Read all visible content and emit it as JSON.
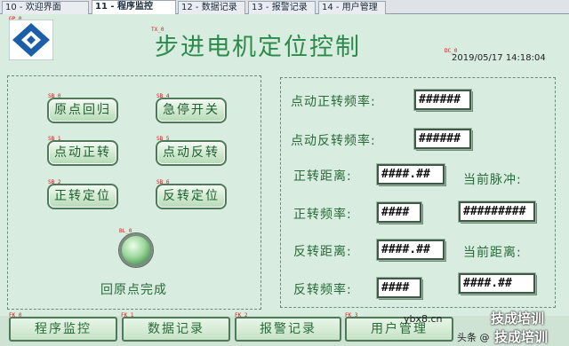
{
  "tabs": [
    {
      "label": "10 - 欢迎界面",
      "active": false
    },
    {
      "label": "11 - 程序监控",
      "active": true
    },
    {
      "label": "12 - 数据记录",
      "active": false
    },
    {
      "label": "13 - 报警记录",
      "active": false
    },
    {
      "label": "14 - 用户管理",
      "active": false
    }
  ],
  "header": {
    "title": "步进电机定位控制",
    "datetime": "2019/05/17 14:18:04",
    "logo_tag": "GP_0",
    "title_tag": "TX_0",
    "date_tag": "DC_0"
  },
  "left_panel": {
    "buttons": [
      {
        "label": "原点回归",
        "tag": "SB_0"
      },
      {
        "label": "急停开关",
        "tag": "SB_4"
      },
      {
        "label": "点动正转",
        "tag": "SB_1"
      },
      {
        "label": "点动反转",
        "tag": "SB_5"
      },
      {
        "label": "正转定位",
        "tag": "SB_2"
      },
      {
        "label": "反转定位",
        "tag": "SB_6"
      }
    ],
    "lamp_tag": "BL_0",
    "lamp_label": "回原点完成"
  },
  "right_panel": {
    "rows": [
      {
        "label": "点动正转频率:",
        "value": "######"
      },
      {
        "label": "点动反转频率:",
        "value": "######"
      },
      {
        "label": "正转距离:",
        "value": "####.##",
        "extra_label": "当前脉冲:"
      },
      {
        "label": "正转频率:",
        "value": "####",
        "extra_value": "#########"
      },
      {
        "label": "反转距离:",
        "value": "####.##",
        "extra_label": "当前距离:"
      },
      {
        "label": "反转频率:",
        "value": "####",
        "extra_value": "####.##"
      }
    ]
  },
  "nav": {
    "buttons": [
      {
        "label": "程序监控",
        "tag": "FK_0"
      },
      {
        "label": "数据记录",
        "tag": "FK_1"
      },
      {
        "label": "报警记录",
        "tag": "FK_2"
      },
      {
        "label": "用户管理",
        "tag": "FK_3"
      }
    ]
  },
  "watermark": {
    "site": "ybx8.cn",
    "brand": "技成培训",
    "prefix": "头条 @"
  },
  "colors": {
    "accent_green": "#2c8a4a",
    "background": "#d8ece0",
    "tag_red": "#d02020"
  }
}
